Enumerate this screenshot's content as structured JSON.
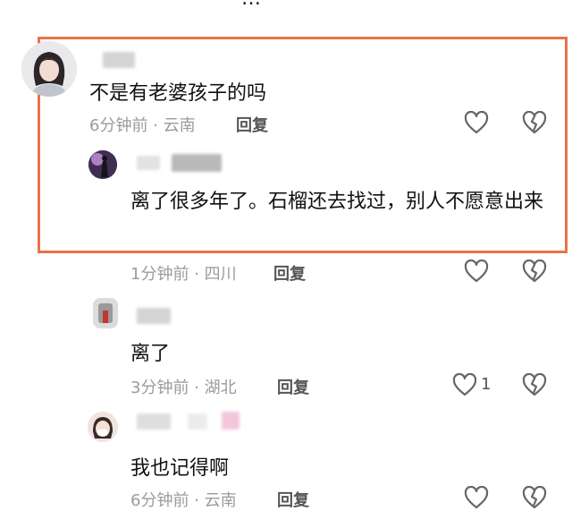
{
  "header": {
    "title_fragment": "…"
  },
  "comments": [
    {
      "text": "不是有老婆孩子的吗",
      "meta": "6分钟前 · 云南",
      "reply_label": "回复",
      "like_count": ""
    },
    {
      "text": "离了很多年了。石榴还去找过，别人不愿意出来",
      "meta": "1分钟前 · 四川",
      "reply_label": "回复",
      "like_count": ""
    },
    {
      "text": "离了",
      "meta": "3分钟前 · 湖北",
      "reply_label": "回复",
      "like_count": "1"
    },
    {
      "text": "我也记得啊",
      "meta": "6分钟前 · 云南",
      "reply_label": "回复",
      "like_count": ""
    }
  ],
  "icons": {
    "like": "heart-outline-icon",
    "dislike": "broken-heart-outline-icon"
  },
  "colors": {
    "highlight_border": "#e8734a",
    "meta_gray": "#9b9b9b"
  }
}
